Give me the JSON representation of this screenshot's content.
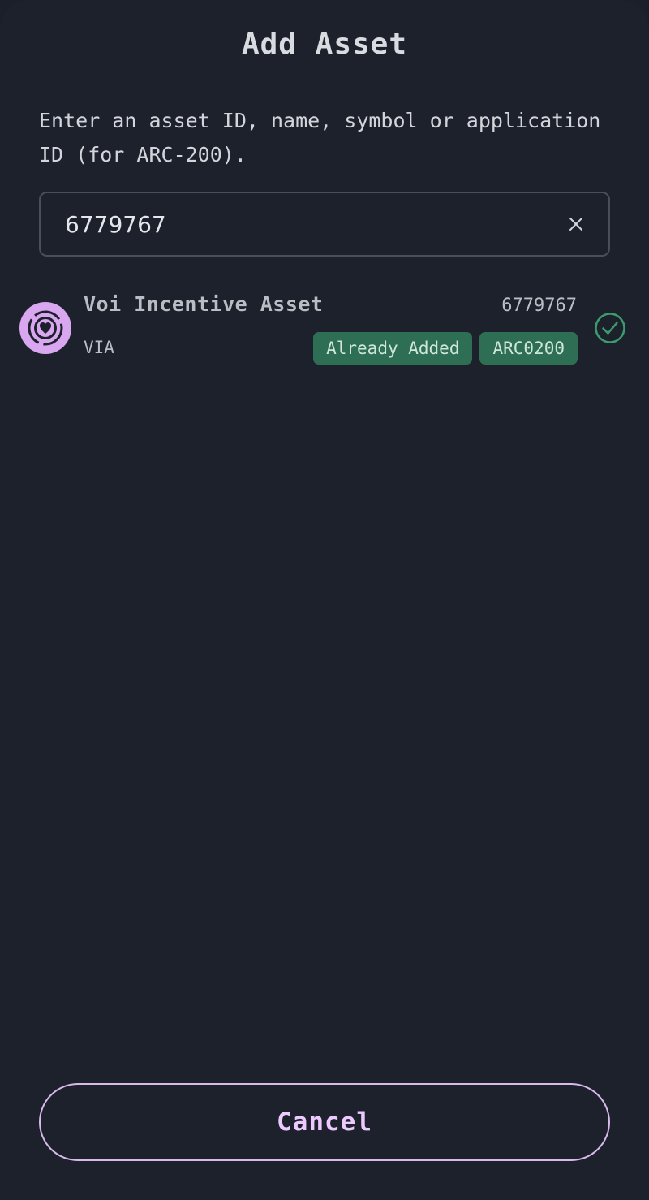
{
  "header": {
    "title": "Add Asset"
  },
  "search": {
    "description": "Enter an asset ID, name, symbol or application ID (for ARC-200).",
    "value": "6779767",
    "placeholder": "",
    "clear_icon": "close-icon"
  },
  "results": [
    {
      "name": "Voi Incentive Asset",
      "symbol": "VIA",
      "asset_id": "6779767",
      "icon": "heart-coin-icon",
      "status_icon": "check-circle-icon",
      "badges": [
        "Already Added",
        "ARC0200"
      ]
    }
  ],
  "footer": {
    "cancel_label": "Cancel"
  },
  "colors": {
    "background": "#1d212c",
    "badge": "#2e6e54",
    "accent": "#ecc9ff",
    "avatar": "#d9a6f0",
    "success": "#3c9c6e"
  }
}
